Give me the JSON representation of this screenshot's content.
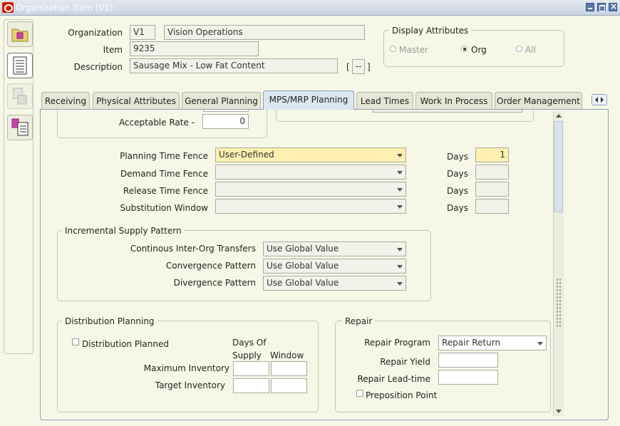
{
  "window": {
    "title": "Organization Item (V1)"
  },
  "header": {
    "organization_label": "Organization",
    "organization_code": "V1",
    "organization_name": "Vision Operations",
    "item_label": "Item",
    "item_value": "9235",
    "description_label": "Description",
    "description_value": "Sausage Mix - Low Fat Content",
    "desc_bracket_open": "[",
    "desc_bracket_mid": "--",
    "desc_bracket_close": "]"
  },
  "display_attributes": {
    "title": "Display Attributes",
    "options": [
      {
        "label": "Master",
        "selected": false
      },
      {
        "label": "Org",
        "selected": true
      },
      {
        "label": "All",
        "selected": false
      }
    ]
  },
  "tabs": [
    {
      "label": "Receiving",
      "active": false
    },
    {
      "label": "Physical Attributes",
      "active": false
    },
    {
      "label": "General Planning",
      "active": false
    },
    {
      "label": "MPS/MRP Planning",
      "active": true
    },
    {
      "label": "Lead Times",
      "active": false
    },
    {
      "label": "Work In Process",
      "active": false
    },
    {
      "label": "Order Management",
      "active": false
    }
  ],
  "acceptable_rate": {
    "label": "Acceptable Rate -",
    "value": "0"
  },
  "fences": {
    "days_label": "Days",
    "rows": [
      {
        "label": "Planning Time Fence",
        "value": "User-Defined",
        "days": "1"
      },
      {
        "label": "Demand Time Fence",
        "value": "",
        "days": ""
      },
      {
        "label": "Release Time Fence",
        "value": "",
        "days": ""
      },
      {
        "label": "Substitution Window",
        "value": "",
        "days": ""
      }
    ]
  },
  "incremental_supply": {
    "title": "Incremental Supply Pattern",
    "rows": [
      {
        "label": "Continous Inter-Org Transfers",
        "value": "Use Global Value"
      },
      {
        "label": "Convergence Pattern",
        "value": "Use Global Value"
      },
      {
        "label": "Divergence Pattern",
        "value": "Use Global Value"
      }
    ]
  },
  "distribution_planning": {
    "title": "Distribution Planning",
    "distribution_planned_label": "Distribution Planned",
    "col_days_of": "Days Of",
    "col_supply": "Supply",
    "col_window": "Window",
    "max_inventory_label": "Maximum Inventory",
    "target_inventory_label": "Target Inventory",
    "max_supply": "",
    "max_window": "",
    "target_supply": "",
    "target_window": ""
  },
  "repair": {
    "title": "Repair",
    "program_label": "Repair Program",
    "program_value": "Repair Return",
    "yield_label": "Repair Yield",
    "yield_value": "",
    "leadtime_label": "Repair Lead-time",
    "leadtime_value": "",
    "preposition_label": "Preposition Point"
  },
  "colors": {
    "active_tab": "#dbe6f2",
    "required_field": "#fdf0b0",
    "titlebar_text": "#ffffff"
  }
}
